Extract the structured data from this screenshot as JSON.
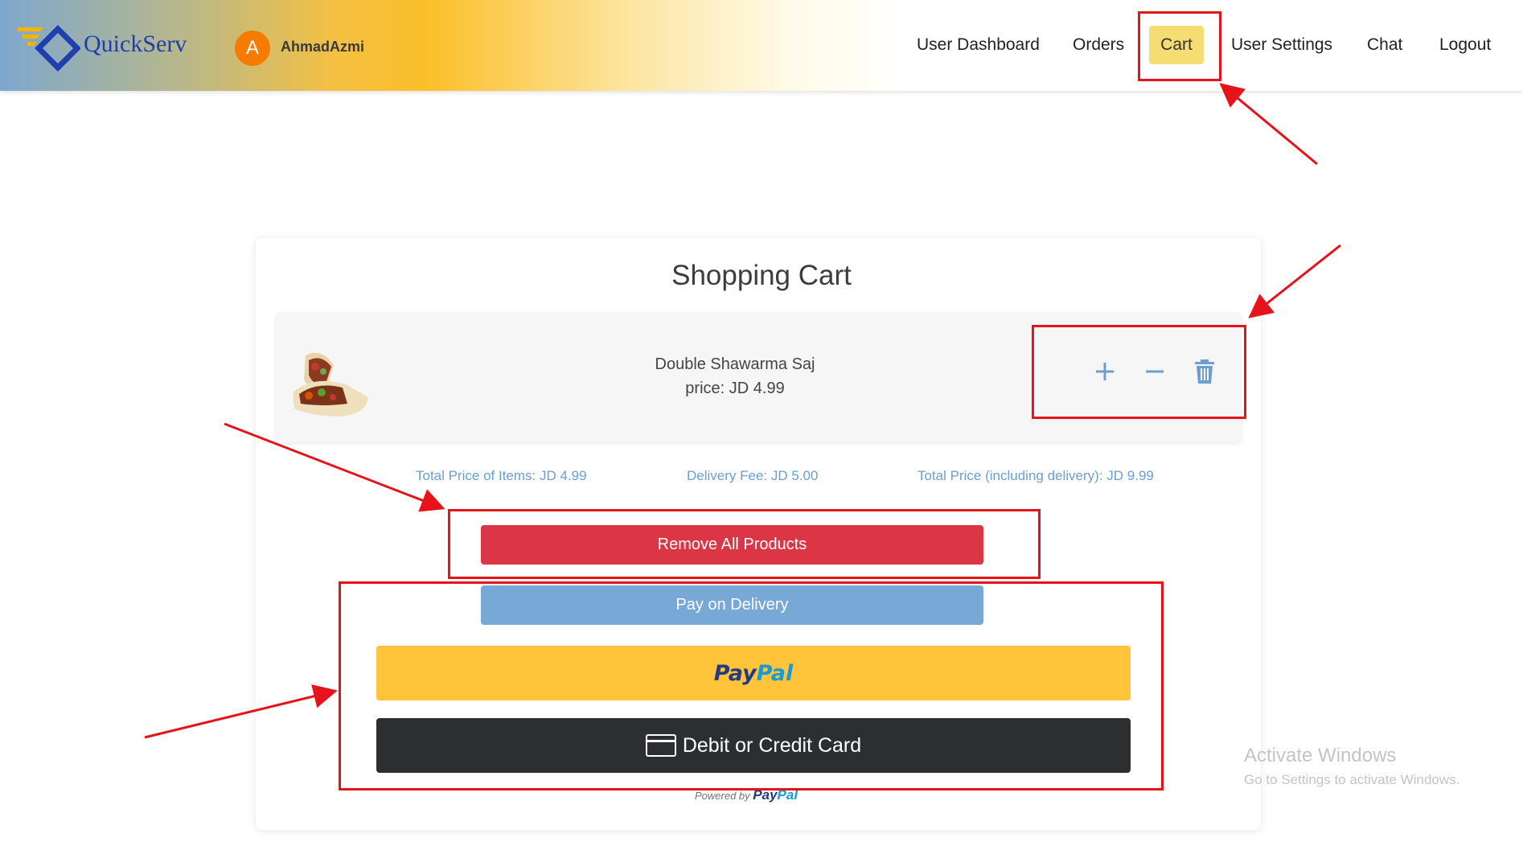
{
  "header": {
    "brand": "QuickServ",
    "avatar_letter": "A",
    "username": "AhmadAzmi",
    "nav": {
      "dashboard": "User Dashboard",
      "orders": "Orders",
      "cart": "Cart",
      "settings": "User Settings",
      "chat": "Chat",
      "logout": "Logout"
    }
  },
  "cart": {
    "title": "Shopping Cart",
    "item": {
      "name": "Double Shawarma Saj",
      "price": "price: JD 4.99"
    },
    "summary": {
      "items_total": "Total Price of Items: JD 4.99",
      "delivery_fee": "Delivery Fee: JD 5.00",
      "grand_total": "Total Price (including delivery): JD 9.99"
    },
    "remove_all_label": "Remove All Products",
    "pay_on_delivery_label": "Pay on Delivery",
    "paypal_pay": "Pay",
    "paypal_pal": "Pal",
    "card_label": "Debit or Credit Card",
    "powered_by": "Powered by"
  },
  "watermark": {
    "line1": "Activate Windows",
    "line2": "Go to Settings to activate Windows."
  },
  "colors": {
    "accent_red": "#dc3545",
    "pay_blue": "#77a8d6",
    "paypal_yellow": "#ffc439",
    "card_dark": "#2c2e2f",
    "annotation_red": "#e8121a"
  }
}
